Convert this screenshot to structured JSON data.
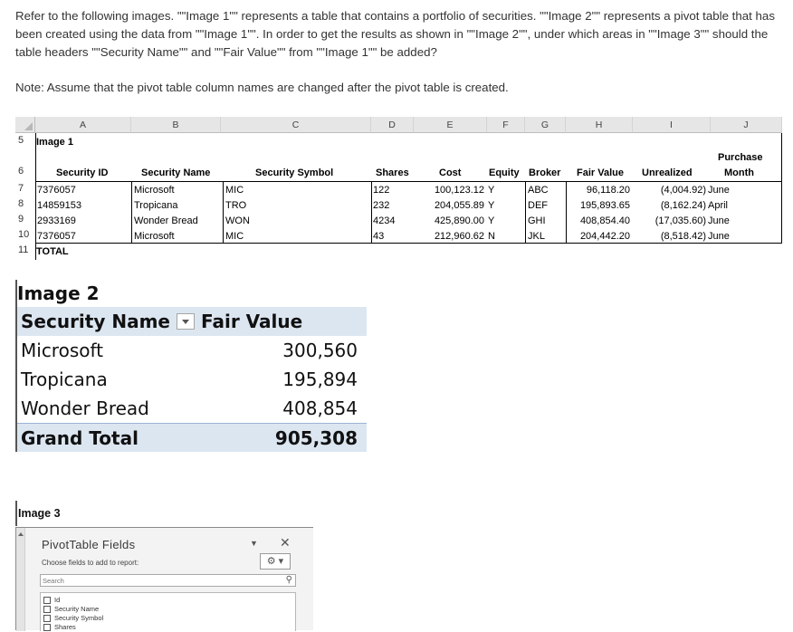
{
  "question": {
    "text": "Refer to the following images. \"\"Image 1\"\" represents a table that contains a portfolio of securities. \"\"Image 2\"\" represents a pivot table that has been created using the data from \"\"Image 1\"\". In order to get the results as shown in \"\"Image 2\"\", under which areas in \"\"Image 3\"\" should the table headers \"\"Security Name\"\" and \"\"Fair Value\"\" from \"\"Image 1\"\" be added?",
    "note": "Note: Assume that the pivot table column names are changed after the pivot table is created."
  },
  "image1": {
    "column_letters": [
      "A",
      "B",
      "C",
      "D",
      "E",
      "F",
      "G",
      "H",
      "I",
      "J"
    ],
    "row_numbers": [
      "5",
      "6",
      "7",
      "8",
      "9",
      "10",
      "11"
    ],
    "title": "Image 1",
    "headers": {
      "security_id": "Security ID",
      "security_name": "Security Name",
      "security_symbol": "Security Symbol",
      "shares": "Shares",
      "cost": "Cost",
      "equity": "Equity",
      "broker": "Broker",
      "fair_value": "Fair Value",
      "unrealized": "Unrealized",
      "purchase_1": "Purchase",
      "purchase_2": "Month"
    },
    "rows": [
      {
        "id": "7376057",
        "name": "Microsoft",
        "symbol": "MIC",
        "shares": "122",
        "cost": "100,123.12",
        "equity": "Y",
        "broker": "ABC",
        "fair_value": "96,118.20",
        "unrealized": "(4,004.92)",
        "month": "June"
      },
      {
        "id": "14859153",
        "name": "Tropicana",
        "symbol": "TRO",
        "shares": "232",
        "cost": "204,055.89",
        "equity": "Y",
        "broker": "DEF",
        "fair_value": "195,893.65",
        "unrealized": "(8,162.24)",
        "month": "April"
      },
      {
        "id": "2933169",
        "name": "Wonder Bread",
        "symbol": "WON",
        "shares": "4234",
        "cost": "425,890.00",
        "equity": "Y",
        "broker": "GHI",
        "fair_value": "408,854.40",
        "unrealized": "(17,035.60)",
        "month": "June"
      },
      {
        "id": "7376057",
        "name": "Microsoft",
        "symbol": "MIC",
        "shares": "43",
        "cost": "212,960.62",
        "equity": "N",
        "broker": "JKL",
        "fair_value": "204,442.20",
        "unrealized": "(8,518.42)",
        "month": "June"
      }
    ],
    "total_label": "TOTAL"
  },
  "image2": {
    "title": "Image 2",
    "header_label": "Security Name",
    "header_value": "Fair Value",
    "rows": [
      {
        "label": "Microsoft",
        "value": "300,560"
      },
      {
        "label": "Tropicana",
        "value": "195,894"
      },
      {
        "label": "Wonder Bread",
        "value": "408,854"
      }
    ],
    "total_label": "Grand Total",
    "total_value": "905,308"
  },
  "image3": {
    "title": "Image 3",
    "panel_title": "PivotTable Fields",
    "subtitle": "Choose fields to add to report:",
    "search_placeholder": "Search",
    "fields": [
      "Id",
      "Security Name",
      "Security Symbol",
      "Shares"
    ],
    "icons": {
      "chevron": "chevron-down-icon",
      "close": "close-icon",
      "gear": "gear-icon",
      "search": "search-icon"
    }
  }
}
